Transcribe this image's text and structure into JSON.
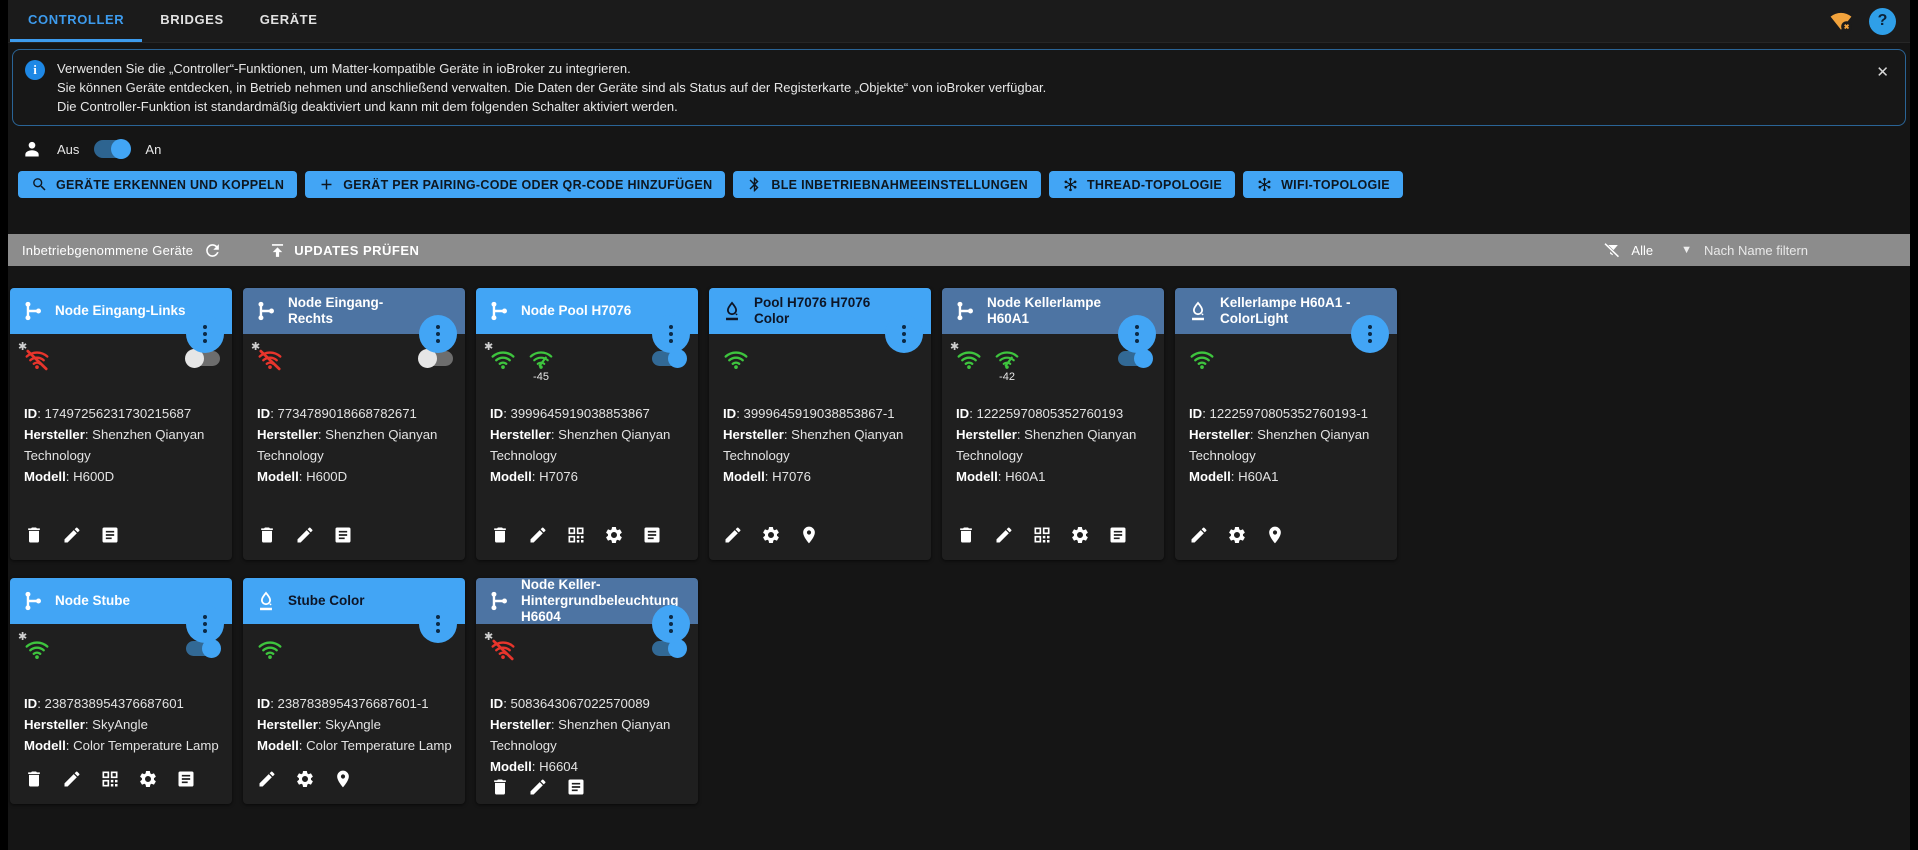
{
  "tabs": [
    {
      "label": "CONTROLLER",
      "active": true
    },
    {
      "label": "BRIDGES",
      "active": false
    },
    {
      "label": "GERÄTE",
      "active": false
    }
  ],
  "header_icons": {
    "connection_warning": "wifi-x-icon",
    "help_label": "?"
  },
  "banner": {
    "lines": [
      "Verwenden Sie die „Controller“-Funktionen, um Matter-kompatible Geräte in ioBroker zu integrieren.",
      "Sie können Geräte entdecken, in Betrieb nehmen und anschließend verwalten. Die Daten der Geräte sind als Status auf der Registerkarte „Objekte“ von ioBroker verfügbar.",
      "Die Controller-Funktion ist standardmäßig deaktiviert und kann mit dem folgenden Schalter aktiviert werden."
    ],
    "close_glyph": "✕"
  },
  "controller_switch": {
    "off_label": "Aus",
    "on_label": "An",
    "state": "on"
  },
  "action_buttons": [
    {
      "icon": "search",
      "label": "GERÄTE ERKENNEN UND KOPPELN"
    },
    {
      "icon": "plus",
      "label": "GERÄT PER PAIRING-CODE ODER QR-CODE HINZUFÜGEN"
    },
    {
      "icon": "bluetooth",
      "label": "BLE INBETRIEBNAHMEEINSTELLUNGEN"
    },
    {
      "icon": "topology",
      "label": "THREAD-TOPOLOGIE"
    },
    {
      "icon": "topology",
      "label": "WIFI-TOPOLOGIE"
    }
  ],
  "toolbar": {
    "title": "Inbetriebgenommene Geräte",
    "updates_label": "UPDATES PRÜFEN",
    "filter_value": "Alle",
    "filter_placeholder": "Nach Name filtern"
  },
  "field_labels": {
    "id": "ID",
    "manufacturer": "Hersteller",
    "model": "Modell"
  },
  "colors": {
    "accent": "#42a5f5",
    "muted_header": "#4d74a3",
    "wifi_connected": "#3ec53e",
    "wifi_disconnected": "#e8352c",
    "warning": "#f2a33c",
    "toolbar_bg": "#8c8c8c"
  },
  "cards": [
    {
      "row": 1,
      "title": "Node Eingang-Links",
      "header": "bright",
      "title_tone": "light",
      "icon": "hub",
      "icon_tone": "light",
      "asterisk": true,
      "wifi": "disconnected",
      "signal": null,
      "toggle": "off",
      "id": "17497256231730215687",
      "manufacturer": "Shenzhen Qianyan Technology",
      "model": "H600D",
      "actions": [
        "delete",
        "edit",
        "log"
      ]
    },
    {
      "row": 1,
      "title": "Node Eingang-Rechts",
      "header": "muted",
      "title_tone": "light",
      "icon": "hub",
      "icon_tone": "light",
      "asterisk": true,
      "wifi": "disconnected",
      "signal": null,
      "toggle": "off",
      "id": "7734789018668782671",
      "manufacturer": "Shenzhen Qianyan Technology",
      "model": "H600D",
      "actions": [
        "delete",
        "edit",
        "log"
      ]
    },
    {
      "row": 1,
      "title": "Node Pool H7076",
      "header": "bright",
      "title_tone": "light",
      "icon": "hub",
      "icon_tone": "light",
      "asterisk": true,
      "wifi": "connected",
      "signal": "-45",
      "toggle": "on",
      "id": "3999645919038853867",
      "manufacturer": "Shenzhen Qianyan Technology",
      "model": "H7076",
      "actions": [
        "delete",
        "edit",
        "qr",
        "settings",
        "log"
      ]
    },
    {
      "row": 1,
      "title": "Pool H7076 H7076 Color",
      "header": "bright",
      "title_tone": "dark",
      "icon": "lamp",
      "icon_tone": "dark",
      "asterisk": false,
      "wifi": "connected",
      "signal": null,
      "toggle": null,
      "id": "3999645919038853867-1",
      "manufacturer": "Shenzhen Qianyan Technology",
      "model": "H7076",
      "actions": [
        "edit",
        "settings",
        "identify"
      ]
    },
    {
      "row": 1,
      "title": "Node Kellerlampe H60A1",
      "header": "muted",
      "title_tone": "light",
      "icon": "hub",
      "icon_tone": "light",
      "asterisk": true,
      "wifi": "connected",
      "signal": "-42",
      "toggle": "on",
      "id": "12225970805352760193",
      "manufacturer": "Shenzhen Qianyan Technology",
      "model": "H60A1",
      "actions": [
        "delete",
        "edit",
        "qr",
        "settings",
        "log"
      ]
    },
    {
      "row": 1,
      "title": "Kellerlampe H60A1 - ColorLight",
      "header": "muted",
      "title_tone": "light",
      "icon": "lamp",
      "icon_tone": "light",
      "asterisk": false,
      "wifi": "connected",
      "signal": null,
      "toggle": null,
      "id": "12225970805352760193-1",
      "manufacturer": "Shenzhen Qianyan Technology",
      "model": "H60A1",
      "actions": [
        "edit",
        "settings",
        "identify"
      ]
    },
    {
      "row": 2,
      "title": "Node Stube",
      "header": "bright",
      "title_tone": "light",
      "icon": "hub",
      "icon_tone": "light",
      "asterisk": true,
      "wifi": "connected",
      "signal": null,
      "toggle": "on",
      "id": "2387838954376687601",
      "manufacturer": "SkyAngle",
      "model": "Color Temperature Lamp",
      "actions": [
        "delete",
        "edit",
        "qr",
        "settings",
        "log"
      ]
    },
    {
      "row": 2,
      "title": "Stube Color",
      "header": "bright",
      "title_tone": "dark",
      "icon": "lamp",
      "icon_tone": "light",
      "asterisk": false,
      "wifi": "connected",
      "signal": null,
      "toggle": null,
      "id": "2387838954376687601-1",
      "manufacturer": "SkyAngle",
      "model": "Color Temperature Lamp",
      "actions": [
        "edit",
        "settings",
        "identify"
      ]
    },
    {
      "row": 2,
      "title": "Node Keller-Hintergrundbeleuchtung H6604",
      "header": "muted",
      "title_tone": "light",
      "icon": "hub",
      "icon_tone": "light",
      "asterisk": true,
      "wifi": "disconnected",
      "signal": null,
      "toggle": "on",
      "id": "5083643067022570089",
      "manufacturer": "Shenzhen Qianyan Technology",
      "model": "H6604",
      "actions": [
        "delete",
        "edit",
        "log"
      ]
    }
  ]
}
